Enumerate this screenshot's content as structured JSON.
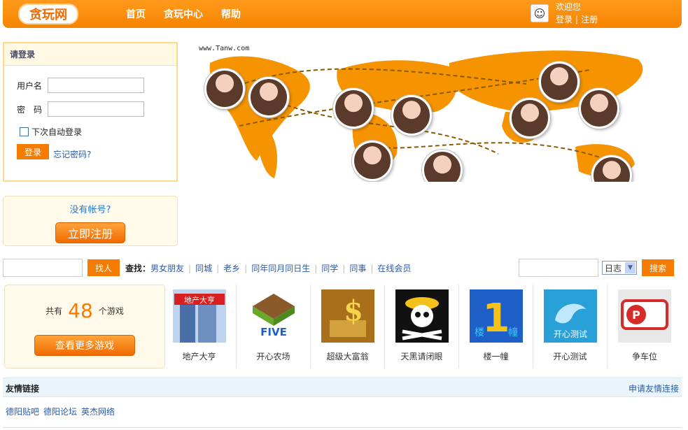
{
  "header": {
    "logo_text": "贪玩网",
    "nav": [
      "首页",
      "贪玩中心",
      "帮助"
    ],
    "welcome": "欢迎您",
    "login_link": "登录",
    "register_link": "注册"
  },
  "login": {
    "title": "请登录",
    "username_label": "用户名",
    "password_label": "密　码",
    "remember_label": "下次自动登录",
    "login_button": "登录",
    "forgot_link": "忘记密码?"
  },
  "register": {
    "question": "没有帐号?",
    "button": "立即注册"
  },
  "banner": {
    "site": "www.Tanw.com"
  },
  "search": {
    "find_button": "找人",
    "find_label": "查找：",
    "links": [
      "男女朋友",
      "同城",
      "老乡",
      "同年同月同日生",
      "同学",
      "同事",
      "在线会员"
    ],
    "select_value": "日志",
    "search_button": "搜索"
  },
  "games": {
    "count_prefix": "共有",
    "count": "48",
    "count_suffix": "个游戏",
    "more_button": "查看更多游戏",
    "items": [
      {
        "name": "地产大亨",
        "icon": "real-estate-tycoon",
        "color": "#3a6fc4"
      },
      {
        "name": "开心农场",
        "icon": "happy-farm",
        "color": "#6aa829"
      },
      {
        "name": "超级大富翁",
        "icon": "super-monopoly",
        "color": "#c88a1a"
      },
      {
        "name": "天黑请闭眼",
        "icon": "pirate-skull",
        "color": "#111111"
      },
      {
        "name": "楼一幢",
        "icon": "tower-one",
        "color": "#1e5fc8"
      },
      {
        "name": "开心测试",
        "icon": "dolphin-test",
        "color": "#27a0d8"
      },
      {
        "name": "争车位",
        "icon": "parking-spot",
        "color": "#d62b2b"
      }
    ]
  },
  "friends": {
    "title": "友情链接",
    "apply": "申请友情连接",
    "links": [
      "德阳贴吧",
      "德阳论坛",
      "英杰网络"
    ]
  },
  "colors": {
    "brand_orange": "#f57c00",
    "link_blue": "#2a5aa8"
  }
}
